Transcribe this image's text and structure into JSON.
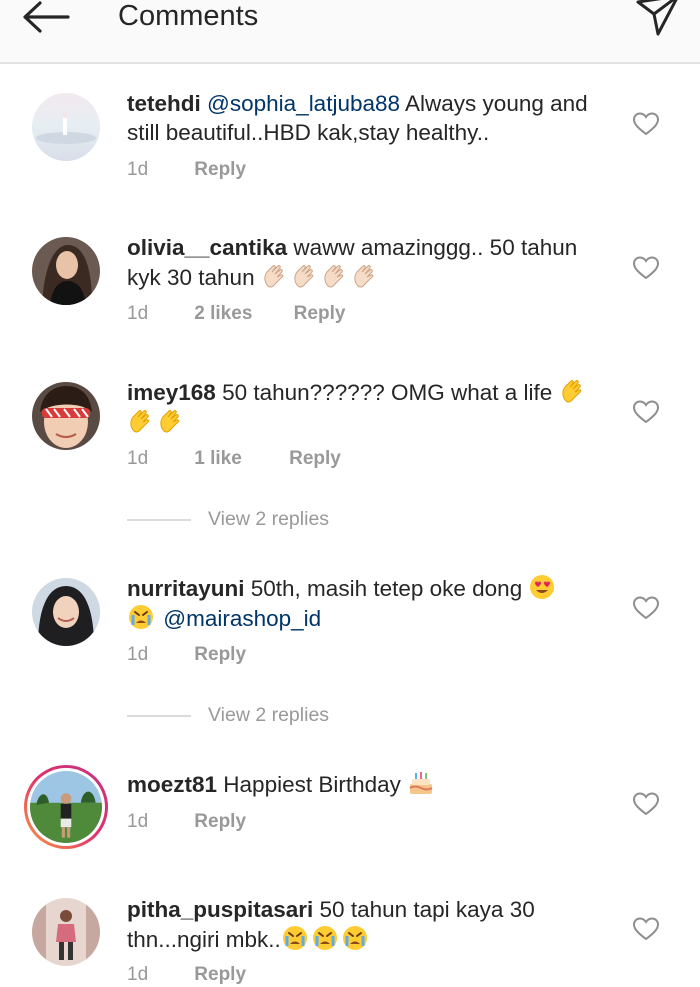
{
  "header": {
    "title": "Comments",
    "back_icon": "arrow-left-icon",
    "send_icon": "paper-plane-icon"
  },
  "comments": [
    {
      "username": "tetehdi",
      "mention": "@sophia_latjuba88",
      "text": " Always young and still beautiful..HBD kak,stay healthy..",
      "time": "1d",
      "likes": "",
      "reply": "Reply"
    },
    {
      "username": "olivia__cantika",
      "text": " waww amazinggg.. 50 tahun kyk 30 tahun ",
      "emoji": "clapping-hands-icon",
      "time": "1d",
      "likes": "2 likes",
      "reply": "Reply"
    },
    {
      "username": "imey168",
      "text": " 50 tahun?????? OMG what a life ",
      "emoji": "clapping-hands-icon",
      "time": "1d",
      "likes": "1 like",
      "reply": "Reply",
      "view_replies": "View 2 replies"
    },
    {
      "username": "nurritayuni",
      "text": " 50th, masih tetep oke dong ",
      "mention": "@mairashop_id",
      "time": "1d",
      "likes": "",
      "reply": "Reply",
      "view_replies": "View 2 replies"
    },
    {
      "username": "moezt81",
      "text": " Happiest Birthday ",
      "emoji": "birthday-cake-icon",
      "time": "1d",
      "likes": "",
      "reply": "Reply"
    },
    {
      "username": "pitha_puspitasari",
      "text": " 50 tahun tapi kaya 30 thn...ngiri mbk..",
      "emoji": "crying-face-icon",
      "time": "1d",
      "likes": "",
      "reply": "Reply"
    }
  ],
  "colors": {
    "mention": "#003569",
    "muted": "#999999",
    "text": "#262626",
    "header_bg": "#fafafa"
  }
}
